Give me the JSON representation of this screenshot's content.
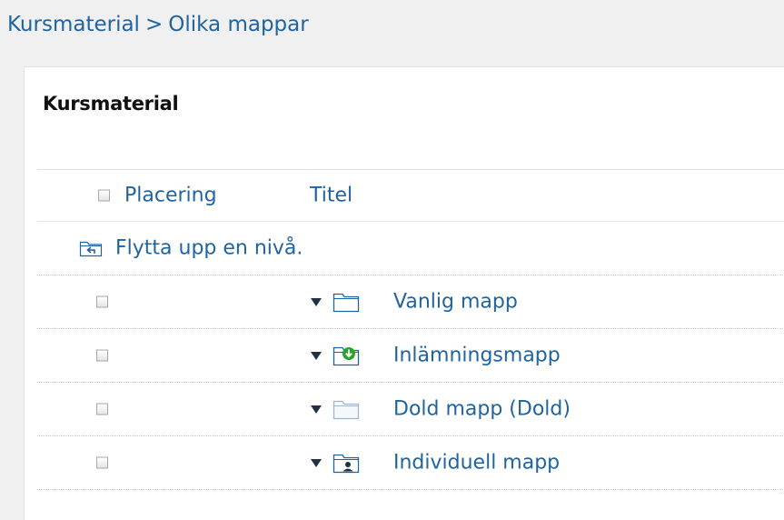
{
  "breadcrumb": {
    "items": [
      "Kursmaterial",
      "Olika mappar"
    ],
    "separator": ">"
  },
  "panel": {
    "title": "Kursmaterial"
  },
  "table": {
    "headers": {
      "placement": "Placering",
      "title": "Titel"
    },
    "up_level_label": "Flytta upp en nivå.",
    "rows": [
      {
        "name": "Vanlig mapp",
        "icon": "folder-icon"
      },
      {
        "name": "Inlämningsmapp",
        "icon": "submission-folder-icon"
      },
      {
        "name": "Dold mapp (Dold)",
        "icon": "hidden-folder-icon"
      },
      {
        "name": "Individuell mapp",
        "icon": "individual-folder-icon"
      }
    ]
  },
  "colors": {
    "link": "#1f64a0",
    "folder_stroke": "#1f64a0",
    "hidden_folder_stroke": "#9fb7cc",
    "submission_badge": "#2aa32a"
  }
}
